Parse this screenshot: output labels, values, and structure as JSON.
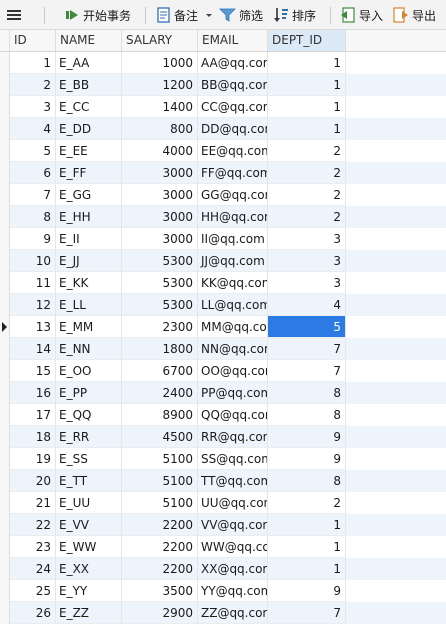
{
  "toolbar": {
    "begin_transaction": "开始事务",
    "note": "备注",
    "filter": "筛选",
    "sort": "排序",
    "import": "导入",
    "export": "导出"
  },
  "columns": [
    "ID",
    "NAME",
    "SALARY",
    "EMAIL",
    "DEPT_ID"
  ],
  "selected_column": "DEPT_ID",
  "selected_row": 13,
  "accent_color": "#2c7be5",
  "rows": [
    {
      "id": "1",
      "name": "E_AA",
      "salary": "1000",
      "email": "AA@qq.com",
      "dept_id": "1"
    },
    {
      "id": "2",
      "name": "E_BB",
      "salary": "1200",
      "email": "BB@qq.com",
      "dept_id": "1"
    },
    {
      "id": "3",
      "name": "E_CC",
      "salary": "1400",
      "email": "CC@qq.com",
      "dept_id": "1"
    },
    {
      "id": "4",
      "name": "E_DD",
      "salary": "800",
      "email": "DD@qq.com",
      "dept_id": "1"
    },
    {
      "id": "5",
      "name": "E_EE",
      "salary": "4000",
      "email": "EE@qq.com",
      "dept_id": "2"
    },
    {
      "id": "6",
      "name": "E_FF",
      "salary": "3000",
      "email": "FF@qq.com",
      "dept_id": "2"
    },
    {
      "id": "7",
      "name": "E_GG",
      "salary": "3000",
      "email": "GG@qq.com",
      "dept_id": "2"
    },
    {
      "id": "8",
      "name": "E_HH",
      "salary": "3000",
      "email": "HH@qq.com",
      "dept_id": "2"
    },
    {
      "id": "9",
      "name": "E_II",
      "salary": "3000",
      "email": "II@qq.com",
      "dept_id": "3"
    },
    {
      "id": "10",
      "name": "E_JJ",
      "salary": "5300",
      "email": "JJ@qq.com",
      "dept_id": "3"
    },
    {
      "id": "11",
      "name": "E_KK",
      "salary": "5300",
      "email": "KK@qq.com",
      "dept_id": "3"
    },
    {
      "id": "12",
      "name": "E_LL",
      "salary": "5300",
      "email": "LL@qq.com",
      "dept_id": "4"
    },
    {
      "id": "13",
      "name": "E_MM",
      "salary": "2300",
      "email": "MM@qq.com",
      "dept_id": "5"
    },
    {
      "id": "14",
      "name": "E_NN",
      "salary": "1800",
      "email": "NN@qq.com",
      "dept_id": "7"
    },
    {
      "id": "15",
      "name": "E_OO",
      "salary": "6700",
      "email": "OO@qq.com",
      "dept_id": "7"
    },
    {
      "id": "16",
      "name": "E_PP",
      "salary": "2400",
      "email": "PP@qq.com",
      "dept_id": "8"
    },
    {
      "id": "17",
      "name": "E_QQ",
      "salary": "8900",
      "email": "QQ@qq.com",
      "dept_id": "8"
    },
    {
      "id": "18",
      "name": "E_RR",
      "salary": "4500",
      "email": "RR@qq.com",
      "dept_id": "9"
    },
    {
      "id": "19",
      "name": "E_SS",
      "salary": "5100",
      "email": "SS@qq.com",
      "dept_id": "9"
    },
    {
      "id": "20",
      "name": "E_TT",
      "salary": "5100",
      "email": "TT@qq.com",
      "dept_id": "8"
    },
    {
      "id": "21",
      "name": "E_UU",
      "salary": "5100",
      "email": "UU@qq.com",
      "dept_id": "2"
    },
    {
      "id": "22",
      "name": "E_VV",
      "salary": "2200",
      "email": "VV@qq.com",
      "dept_id": "1"
    },
    {
      "id": "23",
      "name": "E_WW",
      "salary": "2200",
      "email": "WW@qq.com",
      "dept_id": "1"
    },
    {
      "id": "24",
      "name": "E_XX",
      "salary": "2200",
      "email": "XX@qq.com",
      "dept_id": "1"
    },
    {
      "id": "25",
      "name": "E_YY",
      "salary": "3500",
      "email": "YY@qq.com",
      "dept_id": "9"
    },
    {
      "id": "26",
      "name": "E_ZZ",
      "salary": "2900",
      "email": "ZZ@qq.com",
      "dept_id": "7"
    }
  ]
}
